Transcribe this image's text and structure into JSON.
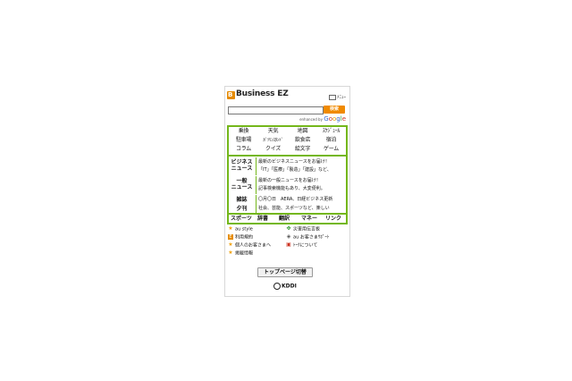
{
  "header": {
    "logo_mark": "B",
    "title": "Business EZ",
    "menu_label": "ﾒﾆｭｰ"
  },
  "search": {
    "value": "",
    "button_label": "検索",
    "enhanced_by": "enhanced by",
    "google": [
      "G",
      "o",
      "o",
      "g",
      "l",
      "e"
    ]
  },
  "services": [
    [
      "乗換",
      "天気",
      "地図",
      "ｽｹｼﾞｭｰﾙ"
    ],
    [
      "駐車場",
      "ｶﾞｿﾘﾝｽﾀﾝﾄﾞ",
      "飲食店",
      "宿泊"
    ],
    [
      "コラム",
      "クイズ",
      "絵文字",
      "ゲーム"
    ]
  ],
  "news": [
    {
      "label": "ビジネス\nニュース",
      "lines": [
        "最新のビジネスニュースをお届け！",
        "「IT」「医療」「製造」「建設」など、"
      ]
    },
    {
      "label": "一般\nニュース",
      "lines": [
        "最新の一般ニュースをお届け！",
        "記事検索機能もあり、大変便利。"
      ]
    },
    {
      "label": "雑誌",
      "lines": [
        "〇月〇日　AERA、日経ビジネス更新"
      ]
    },
    {
      "label": "夕刊",
      "lines": [
        "社会、芸能、スポーツなど、楽しい"
      ]
    }
  ],
  "bottom_nav": [
    "スポーツ",
    "辞書",
    "翻訳",
    "マネー",
    "リンク"
  ],
  "footer_links": [
    {
      "label": "au style",
      "icon": "star-icon",
      "color": "#f0a000"
    },
    {
      "label": "災害用伝言板",
      "icon": "clover-icon",
      "color": "#339933"
    },
    {
      "label": "利用規約",
      "icon": "e-mark-icon",
      "color": "#e58a00"
    },
    {
      "label": "au お客さまｻﾎﾟｰﾄ",
      "icon": "shield-icon",
      "color": "#555555"
    },
    {
      "label": "個人のお客さまへ",
      "icon": "star-icon",
      "color": "#f0a000"
    },
    {
      "label": "ﾄｰｸについて",
      "icon": "talk-icon",
      "color": "#cc3322"
    },
    {
      "label": "掲載情報",
      "icon": "star-icon",
      "color": "#f0a000"
    }
  ],
  "top_page_button": "トップページ切替",
  "brand": "KDDI",
  "colors": {
    "accent_green": "#74b71b",
    "orange": "#f08a00"
  }
}
